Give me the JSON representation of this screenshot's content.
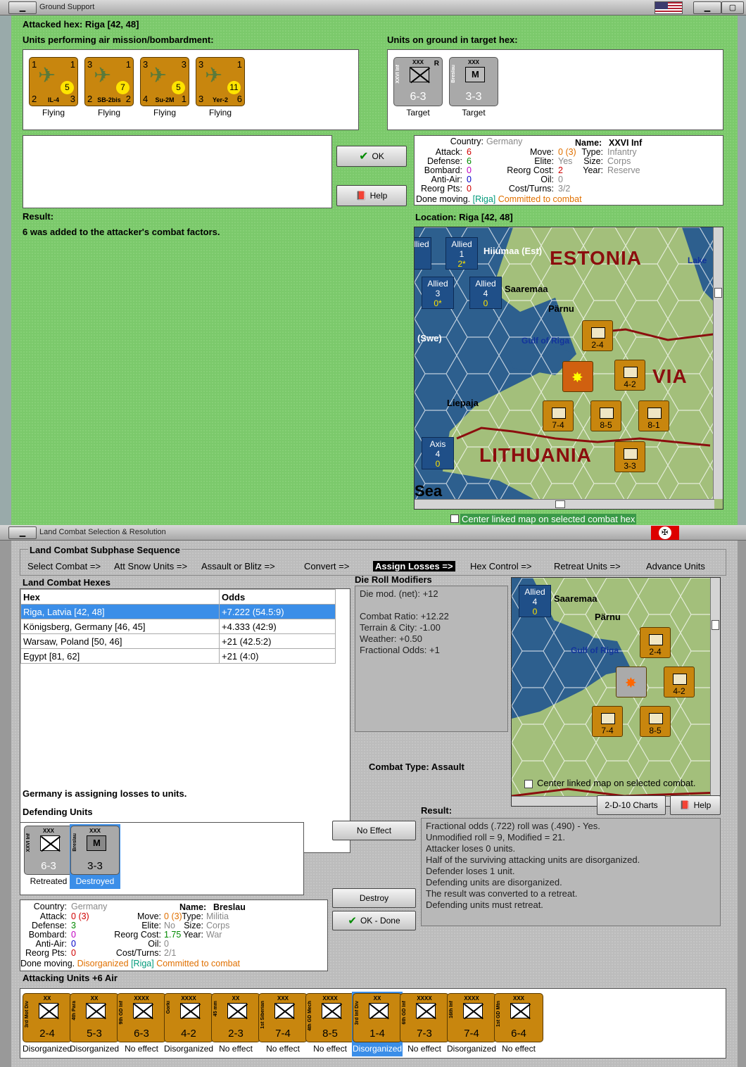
{
  "top_window": {
    "title": "Ground Support",
    "attacked_hex": "Attacked hex: Riga  [42, 48]",
    "air_label": "Units performing air mission/bombardment:",
    "ground_label": "Units on ground in target hex:",
    "air_units": [
      {
        "name": "IL-4",
        "tag": "DB-3",
        "tl": "1",
        "tr": "1",
        "bl": "2",
        "br": "3",
        "range": "5",
        "status": "Flying"
      },
      {
        "name": "SB-2bis",
        "tag": "",
        "tl": "3",
        "tr": "1",
        "bl": "2",
        "br": "2",
        "range": "7",
        "status": "Flying"
      },
      {
        "name": "Su-2M",
        "tag": "",
        "tl": "3",
        "tr": "3",
        "bl": "4",
        "br": "1",
        "range": "5",
        "status": "Flying"
      },
      {
        "name": "Yer-2",
        "tag": "",
        "tl": "3",
        "tr": "1",
        "bl": "3",
        "br": "6",
        "range": "11",
        "status": "Flying"
      }
    ],
    "ground_units": [
      {
        "name": "XXVI Inf",
        "ech": "XXX",
        "mark": "R",
        "str": "6-3",
        "status": "Target"
      },
      {
        "name": "Breslau",
        "ech": "XXX",
        "mark": "",
        "str": "3-3",
        "status": "Target"
      }
    ],
    "ok": "OK",
    "help": "Help",
    "unit_info": {
      "country_k": "Country:",
      "country": "Germany",
      "name_k": "Name:",
      "name": "XXVI Inf",
      "attack_k": "Attack:",
      "attack": "6",
      "defense_k": "Defense:",
      "defense": "6",
      "bombard_k": "Bombard:",
      "bombard": "0",
      "aa_k": "Anti-Air:",
      "aa": "0",
      "reorg_k": "Reorg Pts:",
      "reorg": "0",
      "move_k": "Move:",
      "move": "0",
      "move2": "(3)",
      "elite_k": "Elite:",
      "elite": "Yes",
      "rcost_k": "Reorg Cost:",
      "rcost": "2",
      "oil_k": "Oil:",
      "oil": "0",
      "ct_k": "Cost/Turns:",
      "ct": "3/2",
      "type_k": "Type:",
      "type": "Infantry",
      "size_k": "Size:",
      "size": "Corps",
      "year_k": "Year:",
      "year": "Reserve",
      "done": "Done moving.",
      "loc": "[Riga]",
      "committed": "Committed to combat"
    },
    "result_label": "Result:",
    "result_text": "6 was added to the attacker's combat factors.",
    "location": "Location:  Riga  [42, 48]",
    "center_linked": "Center linked map on selected combat hex",
    "map": {
      "estonia": "ESTONIA",
      "latvia": "VIA",
      "lithuania": "LITHUANIA",
      "hiiumaa": "Hiiumaa (Est)",
      "saaremaa": "Saaremaa",
      "parnu": "Pärnu",
      "gulf": "Gulf of Riga",
      "swe": "(Swe)",
      "liepaja": "Liepaja",
      "lake": "Lake",
      "sea": "Sea",
      "boxes": [
        {
          "t": "Allied",
          "n": "1",
          "v": "2*"
        },
        {
          "t": "Allied",
          "n": "3",
          "v": "0*"
        },
        {
          "t": "Allied",
          "n": "4",
          "v": "0"
        },
        {
          "t": "Axis",
          "n": "4",
          "v": "0"
        }
      ],
      "counters": [
        "2-4",
        "4-2",
        "7-4",
        "8-5",
        "8-1",
        "3-3"
      ]
    }
  },
  "bottom_window": {
    "title": "Land Combat Selection & Resolution",
    "seq_title": "Land Combat Subphase Sequence",
    "seq": [
      "Select Combat =>",
      "Att Snow Units =>",
      "Assault or Blitz =>",
      "Convert =>",
      "Assign Losses =>",
      "Hex Control =>",
      "Retreat Units =>",
      "Advance Units"
    ],
    "hexes_label": "Land Combat Hexes",
    "col_hex": "Hex",
    "col_odds": "Odds",
    "rows": [
      {
        "hex": "Riga, Latvia [42, 48]",
        "odds": "+7.222 (54.5:9)"
      },
      {
        "hex": "Königsberg, Germany [46, 45]",
        "odds": "+4.333 (42:9)"
      },
      {
        "hex": "Warsaw, Poland [50, 46]",
        "odds": "+21 (42.5:2)"
      },
      {
        "hex": "Egypt [81, 62]",
        "odds": "+21 (4:0)"
      }
    ],
    "drm_label": "Die Roll Modifiers",
    "drm": [
      "Die mod. (net): +12",
      "",
      "Combat Ratio: +12.22",
      "Terrain & City: -1.00",
      "Weather: +0.50",
      "Fractional Odds: +1"
    ],
    "combat_type": "Combat Type:  Assault",
    "center_linked": "Center linked map on selected combat.",
    "charts": "2-D-10 Charts",
    "help": "Help",
    "assigning": "Germany is assigning losses to units.",
    "defending_label": "Defending Units",
    "defenders": [
      {
        "name": "XXVI Inf",
        "str": "6-3",
        "status": "Retreated"
      },
      {
        "name": "Breslau",
        "str": "3-3",
        "status": "Destroyed"
      }
    ],
    "no_effect": "No Effect",
    "destroy": "Destroy",
    "ok_done": "OK - Done",
    "result_label": "Result:",
    "result": [
      "Fractional odds (.722) roll was (.490)  - Yes.",
      "Unmodified roll = 9, Modified = 21.",
      "Attacker loses 0 units.",
      "Half of the surviving attacking units are disorganized.",
      "Defender loses 1 unit.",
      "Defending units are disorganized.",
      "The result was converted to a retreat.",
      "Defending units must retreat."
    ],
    "unit_info": {
      "country": "Germany",
      "name": "Breslau",
      "attack": "0",
      "attack2": "(3)",
      "defense": "3",
      "bombard": "0",
      "aa": "0",
      "reorg": "0",
      "move": "0",
      "move2": "(3)",
      "elite": "No",
      "rcost": "1.75",
      "oil": "0",
      "ct": "2/1",
      "type": "Militia",
      "size": "Corps",
      "year": "War",
      "done": "Done moving.",
      "dis": "Disorganized",
      "loc": "[Riga]",
      "committed": "Committed to combat"
    },
    "attacking_label": "Attacking Units +6 Air",
    "attackers": [
      {
        "name": "3rd Mot Div",
        "ech": "XX",
        "str": "2-4",
        "status": "Disorganized"
      },
      {
        "name": "4th Para",
        "ech": "XX",
        "str": "5-3",
        "status": "Disorganized"
      },
      {
        "name": "9th GD Inf",
        "ech": "XXXX",
        "str": "6-3",
        "status": "No effect"
      },
      {
        "name": "Gorki",
        "ech": "XXXX",
        "str": "4-2",
        "status": "Disorganized"
      },
      {
        "name": "45 mm",
        "ech": "XX",
        "str": "2-3",
        "status": "No effect"
      },
      {
        "name": "1st Siberian",
        "ech": "XXX",
        "str": "7-4",
        "status": "No effect"
      },
      {
        "name": "4th GD Mech",
        "ech": "XXXX",
        "str": "8-5",
        "status": "No effect"
      },
      {
        "name": "3rd Inf Div",
        "ech": "XX",
        "str": "1-4",
        "status": "Disorganized"
      },
      {
        "name": "6th GD Inf",
        "ech": "XXXX",
        "str": "7-3",
        "status": "No effect"
      },
      {
        "name": "16th Inf",
        "ech": "XXXX",
        "str": "7-4",
        "status": "Disorganized"
      },
      {
        "name": "1st GD Mtn",
        "ech": "XXX",
        "str": "6-4",
        "status": "No effect"
      }
    ]
  }
}
